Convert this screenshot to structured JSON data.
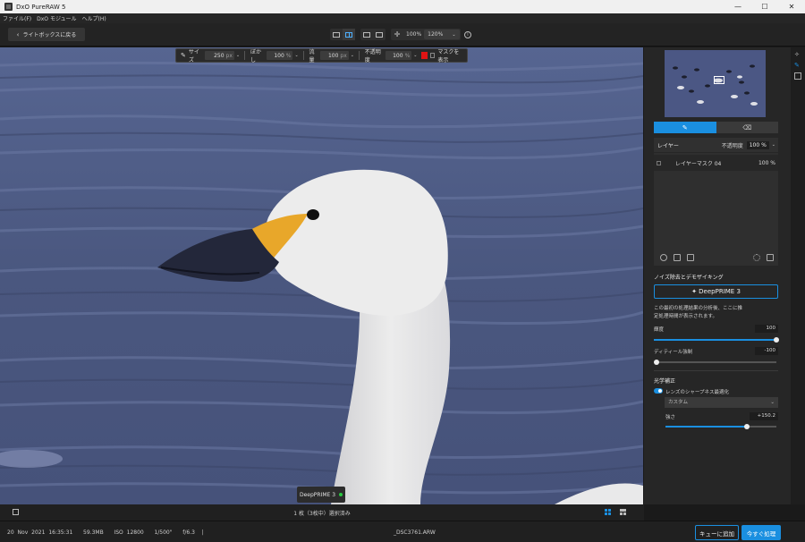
{
  "window": {
    "title": "DxO PureRAW 5",
    "minimize": "—",
    "maximize": "☐",
    "close": "✕"
  },
  "menu": [
    "ファイル(F)",
    "DxO モジュール",
    "ヘルプ(H)"
  ],
  "toolbar": {
    "back_label": "ライトボックスに戻る",
    "zoom_fit": "100%",
    "zoom_value": "120%"
  },
  "brush_toolbar": {
    "size_label": "サイズ",
    "size_value": "250",
    "size_unit": "px",
    "feather_label": "ぼかし",
    "feather_value": "100",
    "feather_unit": "%",
    "flow_label": "流量",
    "flow_value": "100",
    "flow_unit": "px",
    "opacity_label": "不透明度",
    "opacity_value": "100",
    "opacity_unit": "%",
    "mask_color": "#e01414",
    "show_mask_label": "マスクを表示"
  },
  "badge": {
    "label": "DeepPRIME 3",
    "status_color": "#28c840"
  },
  "panel": {
    "layers_label": "レイヤー",
    "opacity_label": "不透明度",
    "opacity_value": "100 %",
    "layers": [
      {
        "name": "レイヤーマスク 04",
        "opacity": "100 %"
      }
    ],
    "noise_section": "ノイズ除去とデモザイキング",
    "dp_button": "✦ DeepPRIME 3",
    "desc_line1": "この最初の処理結果の分析後、ここに推",
    "desc_line2": "定処理時間が表示されます。",
    "luminance_label": "輝度",
    "luminance_value": "100",
    "luminance_level": 1.0,
    "detail_label": "ディティール強制",
    "detail_value": "-100",
    "detail_level": 0.0,
    "optics_section": "光学補正",
    "lens_sharp_label": "レンズのシャープネス最適化",
    "lens_sharp_on": true,
    "preset_value": "カスタム",
    "strength_label": "強さ",
    "strength_value": "+150.2",
    "strength_level": 0.73
  },
  "filmstrip": {
    "selection_text": "1 枚（3枚中）選択済み"
  },
  "status": {
    "date": "20 Nov 2021 16:35:31",
    "size": "59.3MB",
    "iso": "ISO 12800",
    "shutter": "1/500\"",
    "aperture": "f/6.3",
    "filename": "_DSC3761.ARW",
    "queue_label": "キューに追加",
    "process_label": "今すぐ処理"
  },
  "colors": {
    "accent": "#1a8fe0",
    "water": "#4d5a80",
    "beak_yellow": "#e8a72a"
  }
}
